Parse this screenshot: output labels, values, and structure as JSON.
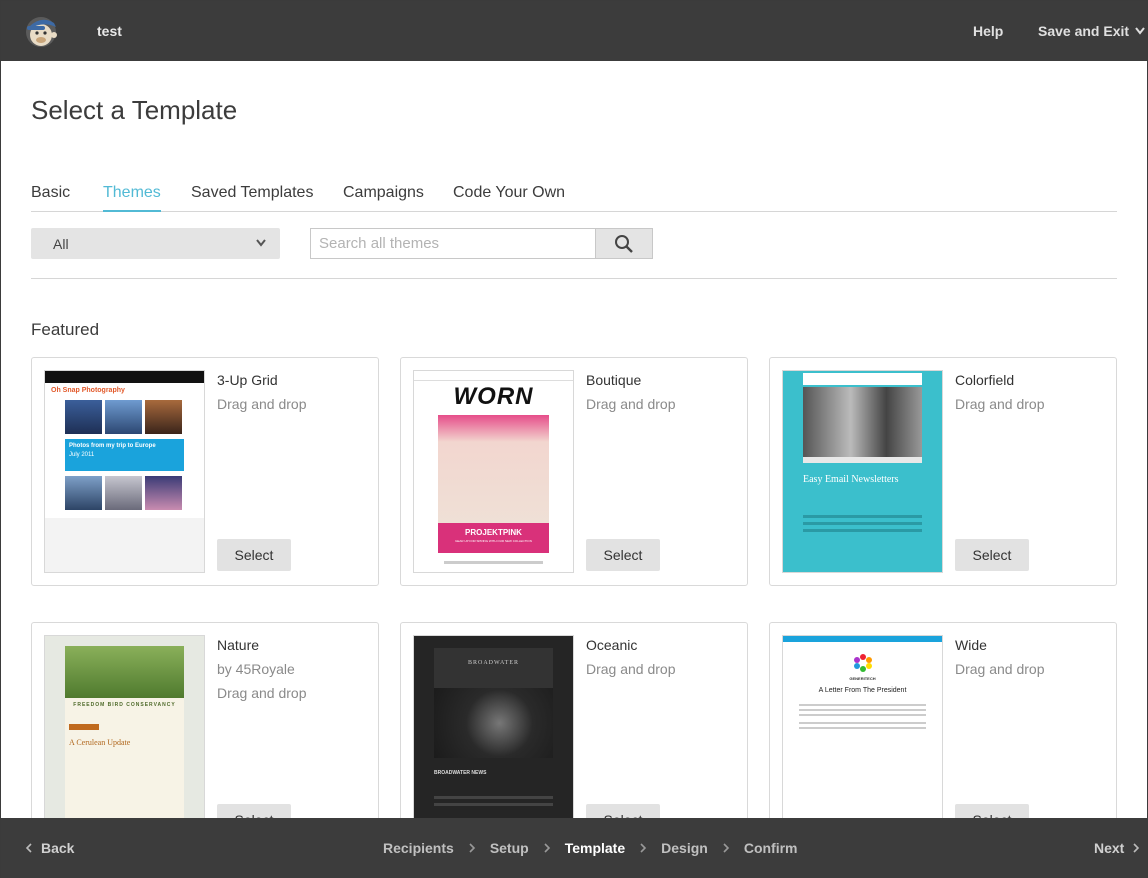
{
  "header": {
    "campaign_name": "test",
    "help": "Help",
    "save_exit": "Save and Exit"
  },
  "page": {
    "title": "Select a Template"
  },
  "tabs": [
    {
      "label": "Basic",
      "active": false
    },
    {
      "label": "Themes",
      "active": true
    },
    {
      "label": "Saved Templates",
      "active": false
    },
    {
      "label": "Campaigns",
      "active": false
    },
    {
      "label": "Code Your Own",
      "active": false
    }
  ],
  "filter": {
    "selected": "All",
    "search_placeholder": "Search all themes"
  },
  "section": {
    "featured": "Featured"
  },
  "templates": [
    {
      "name": "3-Up Grid",
      "sub1": "Drag and drop",
      "sub2": "",
      "button": "Select",
      "thumb": {
        "brand": "Oh Snap Photography",
        "headline": "Photos from my trip to Europe",
        "date": "July 2011"
      }
    },
    {
      "name": "Boutique",
      "sub1": "Drag and drop",
      "sub2": "",
      "button": "Select",
      "thumb": {
        "logo": "WORN",
        "banner": "PROJEKTPINK",
        "tagline": "GEAR UP FOR SPRING WITH OUR NEW COLLECTION"
      }
    },
    {
      "name": "Colorfield",
      "sub1": "Drag and drop",
      "sub2": "",
      "button": "Select",
      "thumb": {
        "headline": "Easy Email Newsletters"
      }
    },
    {
      "name": "Nature",
      "sub1": "by 45Royale",
      "sub2": "Drag and drop",
      "button": "Select",
      "thumb": {
        "brand": "FREEDOM BIRD CONSERVANCY",
        "headline": "A Cerulean Update"
      }
    },
    {
      "name": "Oceanic",
      "sub1": "Drag and drop",
      "sub2": "",
      "button": "Select",
      "thumb": {
        "brand": "BROADWATER",
        "headline": "BROADWATER NEWS"
      }
    },
    {
      "name": "Wide",
      "sub1": "Drag and drop",
      "sub2": "",
      "button": "Select",
      "thumb": {
        "brand": "GENERITECH",
        "headline": "A Letter From The President"
      }
    }
  ],
  "footer": {
    "back": "Back",
    "next": "Next",
    "steps": [
      {
        "label": "Recipients",
        "current": false
      },
      {
        "label": "Setup",
        "current": false
      },
      {
        "label": "Template",
        "current": true
      },
      {
        "label": "Design",
        "current": false
      },
      {
        "label": "Confirm",
        "current": false
      }
    ]
  },
  "colors": {
    "topbar": "#3c3c3c",
    "accent": "#52bad5",
    "button_bg": "#e2e2e2"
  }
}
